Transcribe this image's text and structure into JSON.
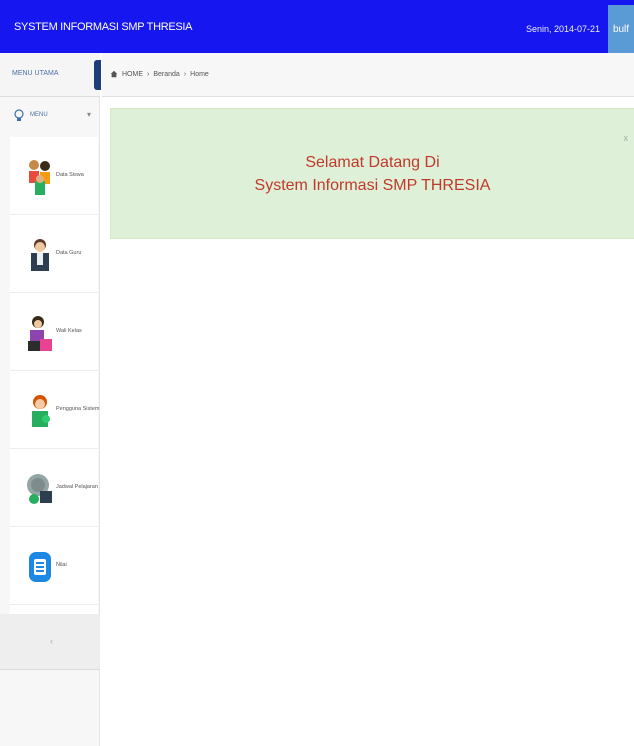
{
  "header": {
    "app_title": "SYSTEM INFORMASI SMP THRESIA",
    "date": "Senin, 2014-07-21",
    "user": "bulf"
  },
  "sidebar": {
    "title": "MENU UTAMA",
    "section_label": "MENU",
    "items": [
      {
        "label": "Data Siswa",
        "icon": "students-icon"
      },
      {
        "label": "Data Guru",
        "icon": "teacher-icon"
      },
      {
        "label": "Wali Kelas",
        "icon": "homeroom-icon"
      },
      {
        "label": "Pengguna Sistem",
        "icon": "user-icon"
      },
      {
        "label": "Jadwal Pelajaran",
        "icon": "schedule-icon"
      },
      {
        "label": "Nilai",
        "icon": "grades-icon"
      }
    ],
    "footer_glyph": "‹"
  },
  "breadcrumb": [
    "HOME",
    "Beranda",
    "Home"
  ],
  "welcome": {
    "line1": "Selamat Datang Di",
    "line2": "System Informasi SMP THRESIA",
    "close": "x"
  },
  "colors": {
    "header_bg": "#1616f0",
    "welcome_bg": "#dff0d8",
    "welcome_text": "#c0392b"
  }
}
